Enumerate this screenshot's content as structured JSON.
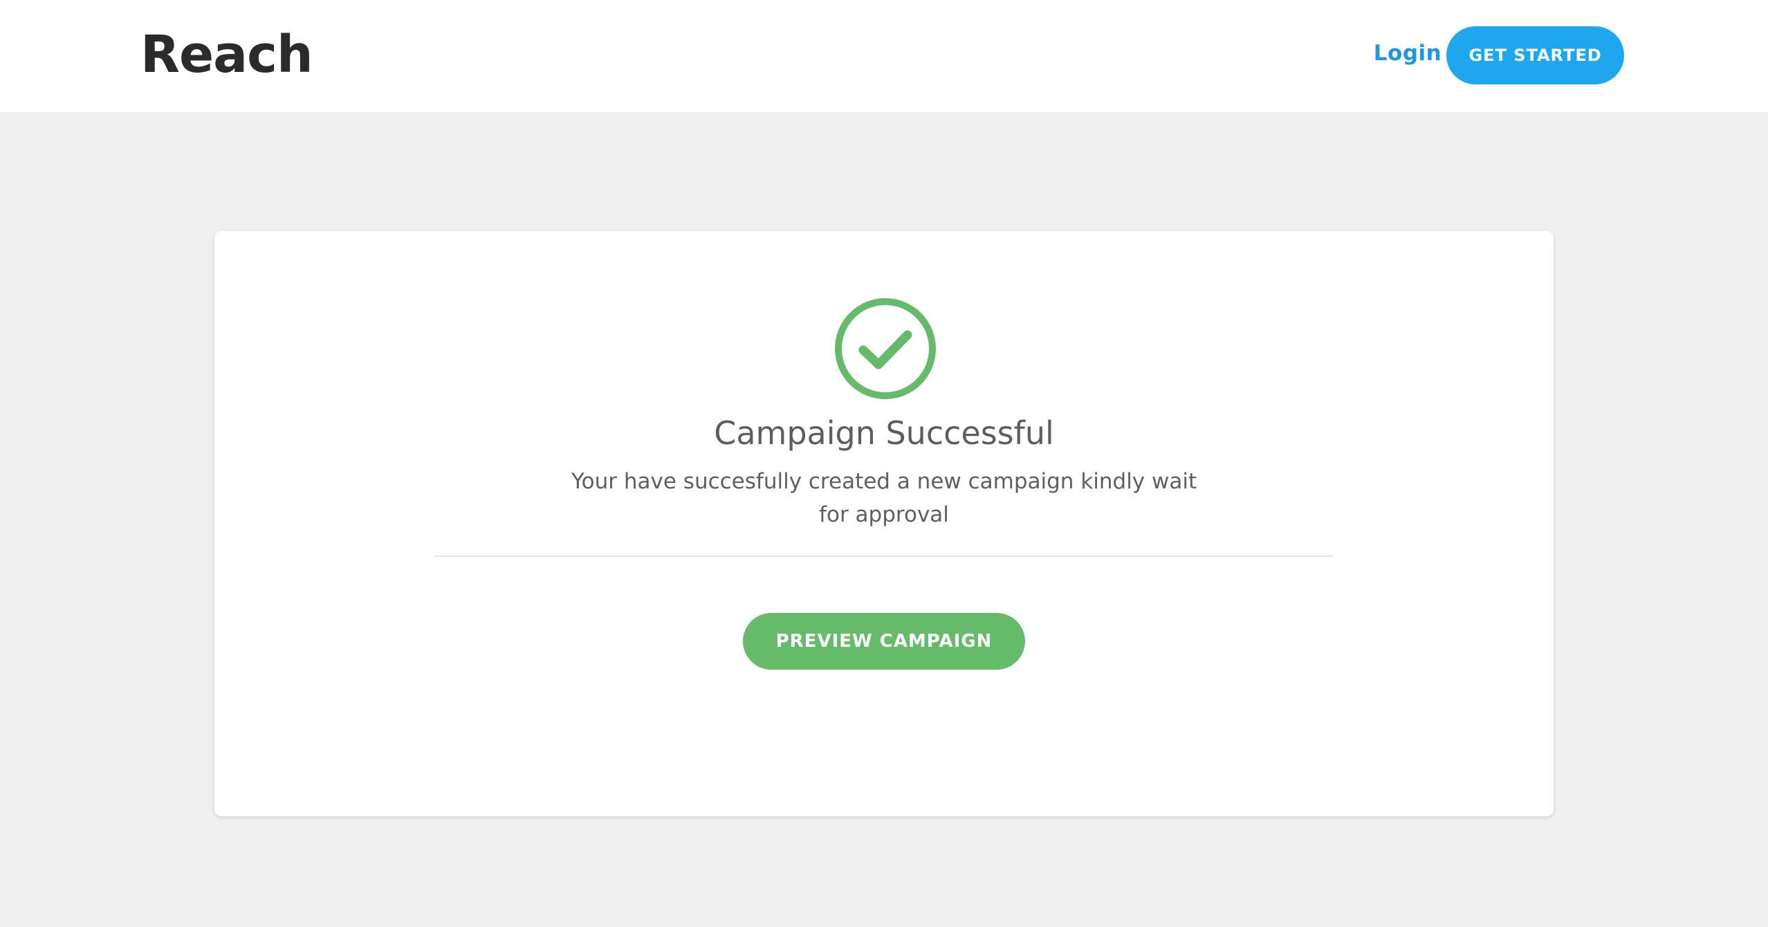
{
  "header": {
    "brand": "Reach",
    "login_label": "Login",
    "get_started_label": "GET STARTED"
  },
  "card": {
    "icon": "check-circle-icon",
    "title": "Campaign Successful",
    "message": "Your have succesfully created a new campaign kindly wait for approval",
    "preview_label": "PREVIEW CAMPAIGN"
  },
  "colors": {
    "page_background": "#efefef",
    "header_background": "#ffffff",
    "brand_text": "#2b2b2b",
    "link_blue": "#2196e0",
    "primary_button": "#1fa7ee",
    "success_green": "#66bb6a",
    "body_text": "#5f5f5f"
  }
}
